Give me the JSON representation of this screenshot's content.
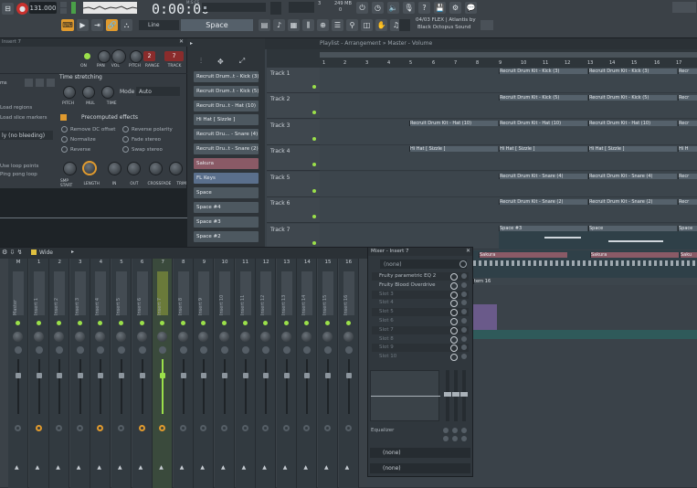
{
  "toolbar": {
    "bpm": "131.000",
    "time": "0:00:00",
    "time_small": "M:S:CS",
    "pattern": "Space",
    "snap": "Line",
    "cpu_mem": "249 MB",
    "cpu_count": "0",
    "voices": "3",
    "hint_title": "04/03 FLEX | Atlantis by",
    "hint_sub": "Black Octopus Sound",
    "breadcrumb": "Playlist - Arrangement » Master - Volume"
  },
  "channel_settings": {
    "title": "Insert 7",
    "labels": [
      "ON",
      "PAN",
      "VOL",
      "PITCH",
      "RANGE",
      "TRACK"
    ],
    "range": "2",
    "track": "7",
    "time_stretching": "Time stretching",
    "knob_labels": [
      "PITCH",
      "MUL",
      "TIME"
    ],
    "mode_label": "Mode",
    "mode_value": "Auto",
    "precomputed": "Precomputed effects",
    "left_options": [
      "Load regions",
      "Load slice markers"
    ],
    "bleeding": "ly (no bleeding)",
    "effects_left": [
      "Remove DC offset",
      "Normalize",
      "Reverse"
    ],
    "effects_right": [
      "Reverse polarity",
      "Fade stereo",
      "Swap stereo"
    ],
    "loop_options": [
      "Use loop points",
      "Ping pong loop"
    ],
    "knob_row": [
      "SMP START",
      "LENGTH",
      "IN",
      "OUT",
      "CROSSFADE",
      "TRIM"
    ]
  },
  "rack": {
    "slots": [
      "Recruit Drum..t - Kick (3)",
      "Recruit Drum..t - Kick (5)",
      "Recruit Dru..t - Hat (10)",
      "Hi Hat [ Sizzle ]",
      "Recruit Dru... - Snare (4)",
      "Recruit Dru..t - Snare (2)",
      "Sakura",
      "FL Keys",
      "Space",
      "Space #4",
      "Space #3",
      "Space #2"
    ]
  },
  "playlist": {
    "bars": [
      "1",
      "2",
      "3",
      "4",
      "5",
      "6",
      "7",
      "8",
      "9",
      "10",
      "11",
      "12",
      "13",
      "14",
      "15",
      "16",
      "17"
    ],
    "tracks": [
      "Track 1",
      "Track 2",
      "Track 3",
      "Track 4",
      "Track 5",
      "Track 6",
      "Track 7"
    ],
    "clips": {
      "t1": [
        "Recruit Drum Kit - Kick (3)",
        "Recruit Drum Kit - Kick (3)",
        "Recruit Drum Kit - Kick (3)",
        "Recr"
      ],
      "t2": [
        "Recruit Drum Kit - Kick (5)",
        "Recruit Drum Kit - Kick (5)",
        "Recruit Drum Kit - Kick (5)",
        "Recr"
      ],
      "t3": [
        "Recruit Drum Kit - Hat (10)",
        "Recruit Drum Kit - Hat (10)",
        "Recruit Drum Kit - Hat (10)",
        "Recruit Drum Kit - Hat (10)",
        "Recr"
      ],
      "t4": [
        "Hi Hat [ Sizzle ]",
        "Hi Hat [ Sizzle ]",
        "Hi Hat [ Sizzle ]",
        "Hi Hat [ Sizzle ]",
        "Hi H"
      ],
      "t5": [
        "Recruit Drum Kit - Snare (4)",
        "Recruit Drum Kit - Snare (4)",
        "Recruit Drum Kit - Snare (4)",
        "Recr"
      ],
      "t6": [
        "Recruit Drum Kit - Snare (2)",
        "Recruit Drum Kit - Snare (2)",
        "Recruit Drum Kit - Snare (2)",
        "Recr"
      ],
      "t7": [
        "Space #3",
        "Space",
        "Space"
      ],
      "t8": [
        "Sakura",
        "Sakura",
        "Saku"
      ],
      "t9": [
        "tern 16"
      ]
    }
  },
  "mixer": {
    "view": "Wide",
    "master": "Master",
    "numbers": [
      "M",
      "1",
      "2",
      "3",
      "4",
      "5",
      "6",
      "7",
      "8",
      "9",
      "10",
      "11",
      "12",
      "13",
      "14",
      "15",
      "16"
    ],
    "inserts": [
      "Insert 1",
      "Insert 2",
      "Insert 3",
      "Insert 4",
      "Insert 5",
      "Insert 6",
      "Insert 7",
      "Insert 8",
      "Insert 9",
      "Insert 10",
      "Insert 11",
      "Insert 12",
      "Insert 13",
      "Insert 14",
      "Insert 15",
      "Insert 16"
    ]
  },
  "insert_panel": {
    "title": "Mixer - Insert 7",
    "input": "(none)",
    "fx": [
      "Fruity parametric EQ 2",
      "Fruity Blood Overdrive"
    ],
    "empty_slots": [
      "Slot 3",
      "Slot 4",
      "Slot 5",
      "Slot 6",
      "Slot 7",
      "Slot 8",
      "Slot 9",
      "Slot 10"
    ],
    "eq_label": "Equalizer",
    "out1": "(none)",
    "out2": "(none)"
  },
  "colors": {
    "accent_green": "#9be04a",
    "orange": "#e09a2e",
    "red": "#c8312e",
    "bg": "#2c3238"
  }
}
